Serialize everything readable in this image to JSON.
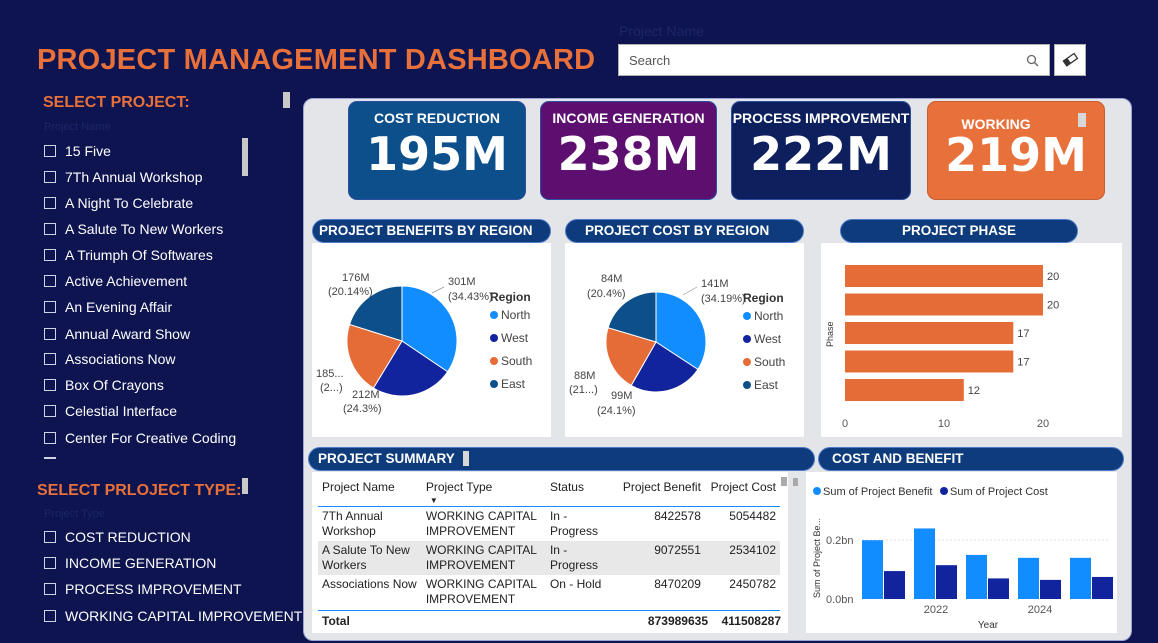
{
  "header": {
    "title": "PROJECT MANAGEMENT DASHBOARD"
  },
  "search": {
    "label": "Project Name",
    "placeholder": "Search"
  },
  "project_slicer": {
    "title": "SELECT PROJECT:",
    "field": "Project Name",
    "items": [
      "15 Five",
      "7Th Annual Workshop",
      "A Night To Celebrate",
      "A Salute To New Workers",
      "A Triumph Of Softwares",
      "Active Achievement",
      "An Evening Affair",
      "Annual Award Show",
      "Associations Now",
      "Box Of Crayons",
      "Celestial Interface",
      "Center For Creative Coding"
    ]
  },
  "type_slicer": {
    "title": "SELECT PRLOJECT  TYPE:",
    "field": "Project Type",
    "items": [
      "COST REDUCTION",
      "INCOME GENERATION",
      "PROCESS IMPROVEMENT",
      "WORKING CAPITAL IMPROVEMENT"
    ]
  },
  "kpis": [
    {
      "label": "COST REDUCTION",
      "value": "195M",
      "color": "#0d4f8b"
    },
    {
      "label": "INCOME GENERATION",
      "value": "238M",
      "color": "#5c0f6e"
    },
    {
      "label": "PROCESS IMPROVEMENT",
      "value": "222M",
      "color": "#0d1f5c"
    },
    {
      "label": "WORKING",
      "value": "219M",
      "color": "#e8703a"
    }
  ],
  "colors": {
    "north": "#118dff",
    "west": "#12239e",
    "south": "#e66c37",
    "east": "#0d4f8b",
    "bar": "#e66c37",
    "benefit": "#118dff",
    "cost": "#12239e"
  },
  "benefits_pie": {
    "title": "PROJECT BENEFITS BY REGION",
    "legend_title": "Region",
    "legend": [
      "North",
      "West",
      "South",
      "East"
    ],
    "labels": {
      "north": "301M",
      "north_pct": "(34.43%)",
      "west": "212M",
      "west_pct": "(24.3%)",
      "south": "185...",
      "south_pct": "(2...)",
      "east": "176M",
      "east_pct": "(20.14%)"
    }
  },
  "cost_pie": {
    "title": "PROJECT COST BY REGION",
    "legend_title": "Region",
    "legend": [
      "North",
      "West",
      "South",
      "East"
    ],
    "labels": {
      "north": "141M",
      "north_pct": "(34.19%)",
      "west": "99M",
      "west_pct": "(24.1%)",
      "south": "88M",
      "south_pct": "(21...)",
      "east": "84M",
      "east_pct": "(20.4%)"
    }
  },
  "phase": {
    "title": "PROJECT PHASE",
    "ylabel": "Phase",
    "ticks": [
      "0",
      "10",
      "20"
    ],
    "values": [
      20,
      20,
      17,
      17,
      12
    ]
  },
  "summary": {
    "title": "PROJECT SUMMARY",
    "columns": [
      "Project Name",
      "Project Type",
      "Status",
      "Project Benefit",
      "Project Cost"
    ],
    "rows": [
      {
        "name": "7Th Annual Workshop",
        "type": "WORKING CAPITAL IMPROVEMENT",
        "status": "In - Progress",
        "benefit": "8422578",
        "cost": "5054482"
      },
      {
        "name": "A Salute To New Workers",
        "type": "WORKING CAPITAL IMPROVEMENT",
        "status": "In - Progress",
        "benefit": "9072551",
        "cost": "2534102"
      },
      {
        "name": "Associations Now",
        "type": "WORKING CAPITAL IMPROVEMENT",
        "status": "On - Hold",
        "benefit": "8470209",
        "cost": "2450782"
      }
    ],
    "total": {
      "label": "Total",
      "benefit": "873989635",
      "cost": "411508287"
    }
  },
  "cost_benefit": {
    "title": "COST AND BENEFIT",
    "legend": [
      "Sum of  Project Benefit",
      "Sum of  Project Cost"
    ],
    "ylabel": "Sum of Project Be...",
    "xlabel": "Year",
    "yticks": [
      "0.0bn",
      "0.2bn"
    ],
    "xticks": [
      "2022",
      "2024"
    ]
  },
  "chart_data": [
    {
      "type": "pie",
      "title": "PROJECT BENEFITS BY REGION",
      "categories": [
        "North",
        "West",
        "South",
        "East"
      ],
      "values": [
        301,
        212,
        185,
        176
      ],
      "percent": [
        34.43,
        24.3,
        null,
        20.14
      ],
      "unit": "M",
      "legend_title": "Region"
    },
    {
      "type": "pie",
      "title": "PROJECT COST BY REGION",
      "categories": [
        "North",
        "West",
        "South",
        "East"
      ],
      "values": [
        141,
        99,
        88,
        84
      ],
      "percent": [
        34.19,
        24.1,
        null,
        20.4
      ],
      "unit": "M",
      "legend_title": "Region"
    },
    {
      "type": "bar",
      "orientation": "horizontal",
      "title": "PROJECT PHASE",
      "ylabel": "Phase",
      "values": [
        20,
        20,
        17,
        17,
        12
      ],
      "xlim": [
        0,
        22
      ]
    },
    {
      "type": "bar",
      "title": "COST AND BENEFIT",
      "xlabel": "Year",
      "ylabel": "Sum of Project Be...",
      "x": [
        2021,
        2022,
        2023,
        2024,
        2025
      ],
      "xticks": [
        "2022",
        "2024"
      ],
      "ylim": [
        0,
        0.3
      ],
      "series": [
        {
          "name": "Sum of  Project Benefit",
          "values": [
            0.2,
            0.24,
            0.15,
            0.14,
            0.14
          ]
        },
        {
          "name": "Sum of  Project Cost",
          "values": [
            0.095,
            0.115,
            0.07,
            0.065,
            0.075
          ]
        }
      ]
    }
  ]
}
